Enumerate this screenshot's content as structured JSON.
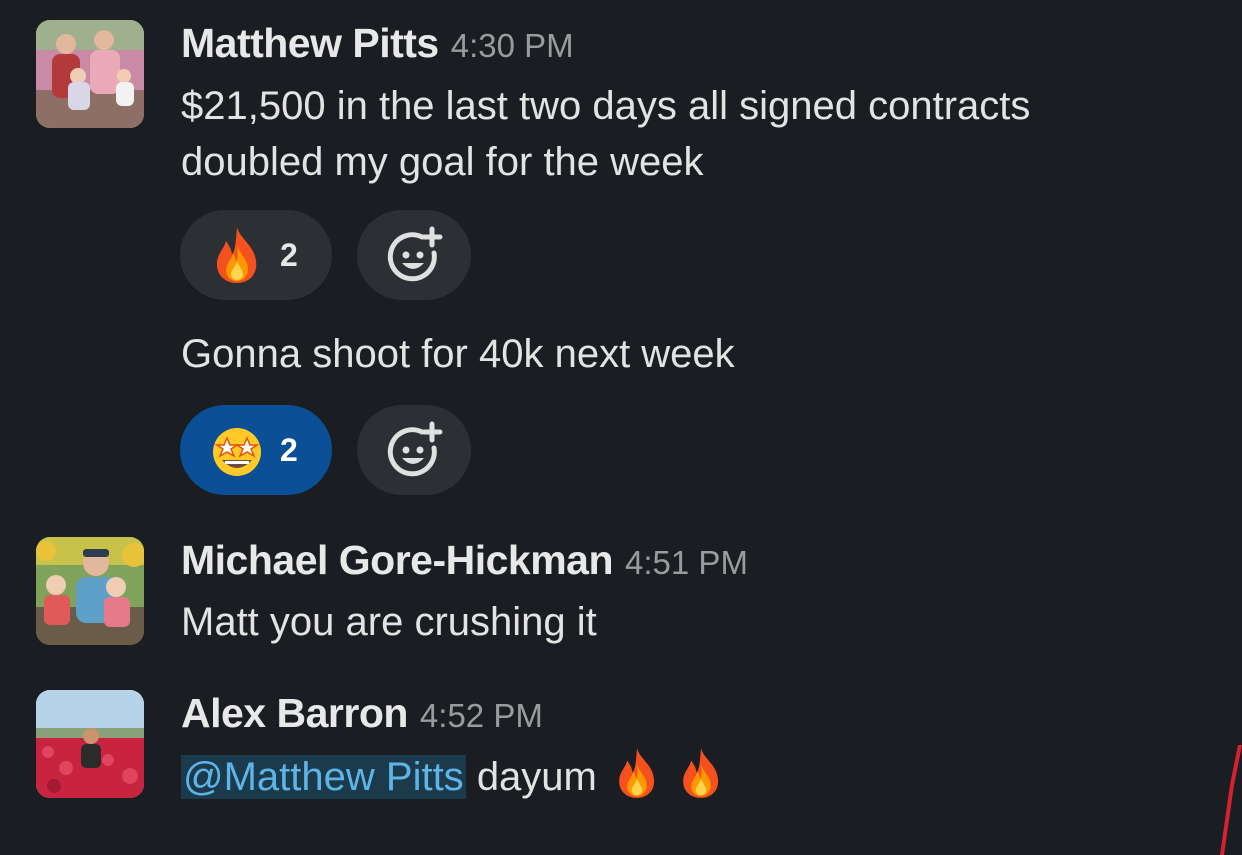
{
  "messages": [
    {
      "author": "Matthew Pitts",
      "time": "4:30 PM",
      "lines": [
        "$21,500 in the last two days all signed contracts",
        "doubled my goal for the week"
      ],
      "reaction": {
        "emoji": "fire",
        "count": "2",
        "active": false
      }
    },
    {
      "author": "Matthew Pitts",
      "text": "Gonna shoot for 40k next week",
      "reaction": {
        "emoji": "star-struck",
        "count": "2",
        "active": true
      }
    },
    {
      "author": "Michael Gore-Hickman",
      "time": "4:51 PM",
      "text": "Matt you are crushing it"
    },
    {
      "author": "Alex Barron",
      "time": "4:52 PM",
      "mention": "@Matthew Pitts",
      "text": "dayum",
      "emojis": [
        "fire",
        "fire"
      ]
    }
  ],
  "colors": {
    "background": "#1a1d21",
    "mention_bg": "#1b3a4c",
    "mention_text": "#5fb4e6",
    "active_reaction": "#0b4f96",
    "reaction_bg": "#2c2f33"
  }
}
